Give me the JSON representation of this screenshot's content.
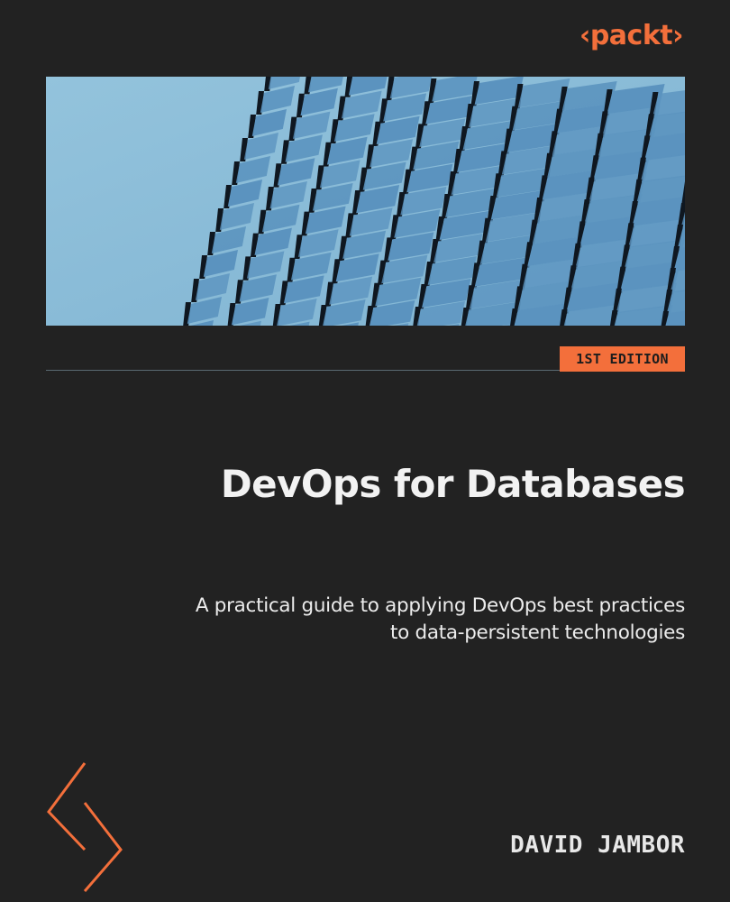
{
  "publisher": {
    "logo_text": "‹packt›"
  },
  "edition_badge": "1ST EDITION",
  "book": {
    "title": "DevOps for Databases",
    "subtitle_lines": [
      "A practical guide to applying DevOps best practices",
      "to data-persistent technologies"
    ],
    "author": "DAVID JAMBOR"
  },
  "colors": {
    "background": "#222222",
    "accent": "#f36f3b",
    "sky": "#8fbfd9",
    "building_panel": "#5b93bf",
    "building_shadow": "#0f1720"
  },
  "icons": {
    "cover_photo": "building-facade-image",
    "corner_mark": "chevron-bracket-mark"
  }
}
